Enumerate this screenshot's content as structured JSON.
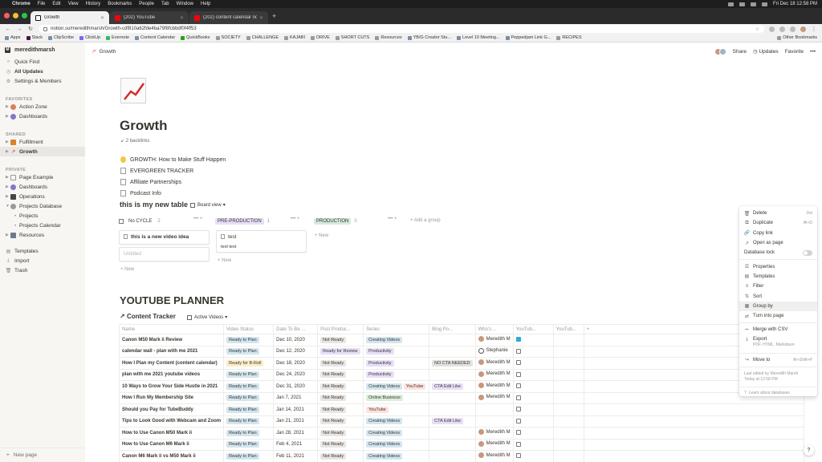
{
  "menubar": {
    "apple": "",
    "items": [
      "Chrome",
      "File",
      "Edit",
      "View",
      "History",
      "Bookmarks",
      "People",
      "Tab",
      "Window",
      "Help"
    ],
    "clock": "Fri Dec 18  12:58 PM"
  },
  "tabs": [
    {
      "label": "Growth",
      "active": true
    },
    {
      "label": "(202) YouTube",
      "active": false
    },
    {
      "label": "(202) content calendar notion",
      "active": false
    }
  ],
  "url": "notion.so/meredithmarsh/Growth-cdf810a62fde4ba79f8fcbbdf0f4ff53",
  "bookmarks": [
    "Apps",
    "Slack",
    "ClipScribe",
    "ClickUp",
    "Evernote",
    "Content Calendar",
    "QuickBooks",
    "SOCIETY",
    "CHALLENGE",
    "KAJABI",
    "DRIVE",
    "SHORT CUTS",
    "Resources",
    "YB/G Creator Stu...",
    "Level 10 Meeting...",
    "Peppedjam Link G...",
    "RECIPES"
  ],
  "bookmarks_other": "Other Bookmarks",
  "sidebar": {
    "workspace": "meredithmarsh",
    "top_items": [
      "Quick Find",
      "All Updates",
      "Settings & Members"
    ],
    "favorites_label": "FAVORITES",
    "favorites": [
      "Action Zone",
      "Dashboards"
    ],
    "shared_label": "SHARED",
    "shared": [
      "Fulfillment",
      "Growth"
    ],
    "private_label": "PRIVATE",
    "private": [
      "Page Example",
      "Dashboards",
      "Operations",
      "Projects Database"
    ],
    "private_sub": [
      "Projects",
      "Projects Calendar"
    ],
    "private_after": [
      "Resources"
    ],
    "bottom": [
      "Templates",
      "Import",
      "Trash"
    ],
    "new_page": "New page"
  },
  "topbar": {
    "breadcrumb": "Growth",
    "share": "Share",
    "updates": "Updates",
    "favorite": "Favorite",
    "more": "•••"
  },
  "page": {
    "title": "Growth",
    "backlinks": "2 backlinks",
    "links": [
      "GROWTH: How to Make Stuff Happen",
      "EVERGREEN TRACKER",
      "Affiliate Partnerships",
      "Podcast Info"
    ]
  },
  "board": {
    "title": "this is my new table",
    "view": "Board view",
    "columns": [
      {
        "label": "No CYCLE",
        "count": "2"
      },
      {
        "label": "PRE-PRODUCTION",
        "count": "1"
      },
      {
        "label": "PRODUCTION",
        "count": "0"
      }
    ],
    "add_group": "+ Add a group",
    "cards": {
      "c1": "this is a new video idea",
      "c2": "Untitled",
      "c3": "test",
      "c3_sub": "text text"
    },
    "new": "+ New"
  },
  "planner": {
    "section": "YOUTUBE PLANNER",
    "db_title": "Content Tracker",
    "view": "Active Videos",
    "headers": [
      "Name",
      "Video Status",
      "Date To Be ...",
      "Post Produc...",
      "Series",
      "Blog Po...",
      "Who's ...",
      "YouTub...",
      "YouTub..."
    ],
    "rows": [
      {
        "name": "Canon M50 Mark ii Review",
        "status": "Ready to Plan",
        "date": "Dec 10, 2020",
        "post": "Not Ready",
        "series": "Creating Videos",
        "blog": "",
        "who": "Meredith M",
        "yt": true
      },
      {
        "name": "calendar wall - plan with me 2021",
        "status": "Ready to Plan",
        "date": "Dec 12, 2020",
        "post": "Ready for Review",
        "series": "Productivity",
        "blog": "",
        "who": "Stephanie",
        "yt": false
      },
      {
        "name": "How I Plan my Content (content calendar)",
        "status": "Ready for B-Roll",
        "date": "Dec 18, 2020",
        "post": "Not Ready",
        "series": "Productivity",
        "blog": "NO CTA NEEDED",
        "who": "Meredith M",
        "yt": false
      },
      {
        "name": "plan with me 2021 youtube videos",
        "status": "Ready to Plan",
        "date": "Dec 24, 2020",
        "post": "Not Ready",
        "series": "Productivity",
        "blog": "",
        "who": "Meredith M",
        "yt": false
      },
      {
        "name": "10 Ways to Grow Your Side Hustle in 2021",
        "status": "Ready to Plan",
        "date": "Dec 31, 2020",
        "post": "Not Ready",
        "series": "Creating Videos",
        "series2": "YouTube",
        "blog": "CTA Edit Like",
        "who": "Meredith M",
        "yt": false
      },
      {
        "name": "How I Run My Membership Site",
        "status": "Ready to Plan",
        "date": "Jan 7, 2021",
        "post": "Not Ready",
        "series": "Online Business",
        "blog": "",
        "who": "Meredith M",
        "yt": false
      },
      {
        "name": "Should you Pay for TubeBuddy",
        "status": "Ready to Plan",
        "date": "Jan 14, 2021",
        "post": "Not Ready",
        "series": "YouTube",
        "blog": "",
        "who": "",
        "yt": false
      },
      {
        "name": "Tips to Look Good with Webcam and Zoom",
        "status": "Ready to Plan",
        "date": "Jan 21, 2021",
        "post": "Not Ready",
        "series": "Creating Videos",
        "blog": "CTA Edit Like",
        "who": "",
        "yt": false
      },
      {
        "name": "How to Use Canon M50 Mark ii",
        "status": "Ready to Plan",
        "date": "Jan 28, 2021",
        "post": "Not Ready",
        "series": "Creating Videos",
        "blog": "",
        "who": "Meredith M",
        "yt": false
      },
      {
        "name": "How to Use Canon M6 Mark ii",
        "status": "Ready to Plan",
        "date": "Feb 4, 2021",
        "post": "Not Ready",
        "series": "Creating Videos",
        "blog": "",
        "who": "Meredith M",
        "yt": false
      },
      {
        "name": "Canon M6 Mark ii vs M50 Mark ii",
        "status": "Ready to Plan",
        "date": "Feb 11, 2021",
        "post": "Not Ready",
        "series": "Creating Videos",
        "blog": "",
        "who": "Meredith M",
        "yt": false
      }
    ]
  },
  "menu": {
    "delete": "Delete",
    "delete_sc": "Del",
    "duplicate": "Duplicate",
    "duplicate_sc": "⌘+D",
    "copy_link": "Copy link",
    "open_as_page": "Open as page",
    "database_lock": "Database lock",
    "properties": "Properties",
    "templates": "Templates",
    "filter": "Filter",
    "sort": "Sort",
    "group_by": "Group by",
    "turn_into_page": "Turn into page",
    "merge_csv": "Merge with CSV",
    "export": "Export",
    "export_sub": "PDF, HTML, Markdown",
    "move_to": "Move to",
    "move_to_sc": "⌘+Shift+P",
    "last_edited": "Last edited by Meredith Marsh",
    "last_edited_time": "Today at 12:58 PM",
    "learn": "Learn about databases"
  },
  "help": "?",
  "colors": {
    "menubar": "#1e1e1e",
    "sidebar": "#f7f6f3",
    "text": "#37352f",
    "checkbox_on": "#2eaadc"
  }
}
